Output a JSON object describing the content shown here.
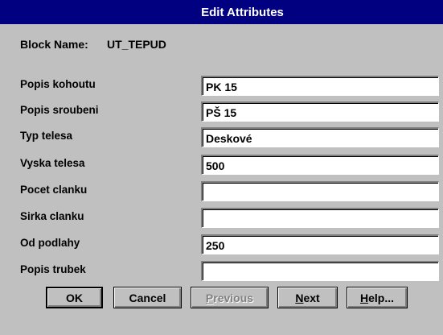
{
  "window": {
    "title": "Edit Attributes"
  },
  "block": {
    "label": "Block Name:",
    "value": "UT_TEPUD"
  },
  "fields": [
    {
      "label": "Popis kohoutu",
      "value": "PK 15"
    },
    {
      "label": "Popis sroubeni",
      "value": "PŠ 15"
    },
    {
      "label": "Typ telesa",
      "value": "Deskové"
    },
    {
      "label": "Vyska telesa",
      "value": "500"
    },
    {
      "label": "Pocet clanku",
      "value": ""
    },
    {
      "label": "Sirka clanku",
      "value": ""
    },
    {
      "label": "Od podlahy",
      "value": "250"
    },
    {
      "label": "Popis trubek",
      "value": ""
    }
  ],
  "buttons": {
    "ok": "OK",
    "cancel": "Cancel",
    "previous_first": "P",
    "previous_rest": "revious",
    "next_first": "N",
    "next_rest": "ext",
    "help_first": "H",
    "help_rest": "elp..."
  },
  "colors": {
    "titlebar": "#000080",
    "dialog_background": "#c0c0c0",
    "input_background": "#ffffff"
  }
}
